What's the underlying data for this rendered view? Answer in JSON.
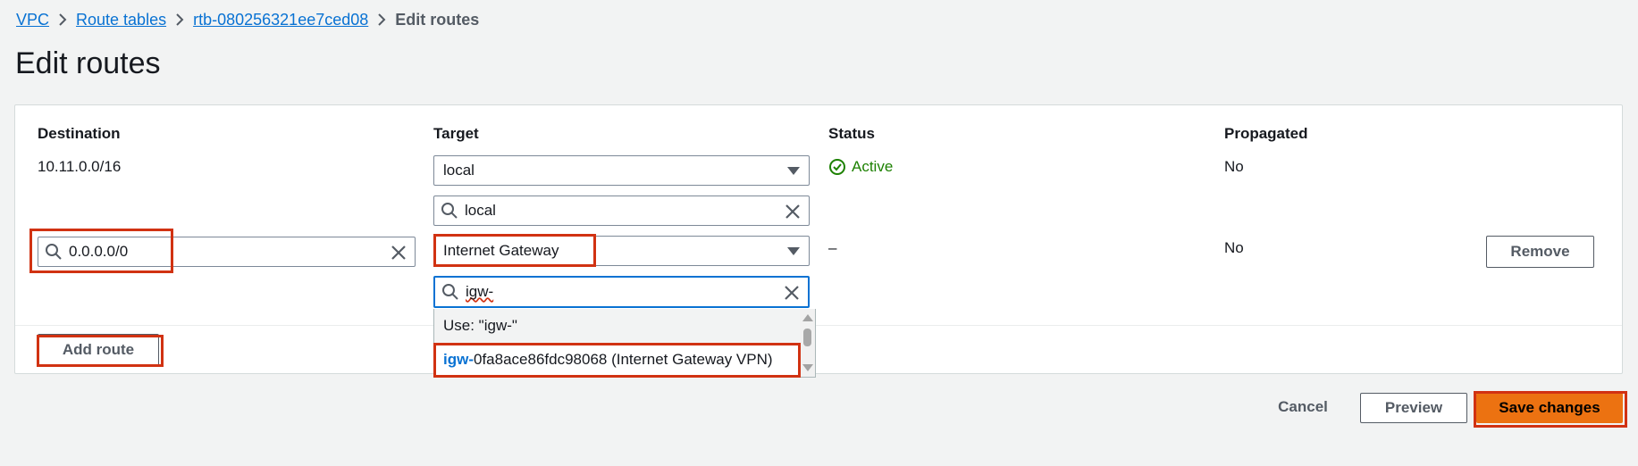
{
  "breadcrumb": {
    "items": [
      "VPC",
      "Route tables",
      "rtb-080256321ee7ced08"
    ],
    "current": "Edit routes"
  },
  "page": {
    "title": "Edit routes"
  },
  "table": {
    "headers": {
      "destination": "Destination",
      "target": "Target",
      "status": "Status",
      "propagated": "Propagated"
    },
    "rows": [
      {
        "destination": "10.11.0.0/16",
        "target_select": "local",
        "target_search": "local",
        "status": "Active",
        "propagated": "No"
      },
      {
        "destination_input": "0.0.0.0/0",
        "target_select": "Internet Gateway",
        "target_search": "igw-",
        "status": "–",
        "propagated": "No",
        "remove_label": "Remove"
      }
    ]
  },
  "dropdown": {
    "use_option": "Use: \"igw-\"",
    "option_match": "igw-",
    "option_rest": "0fa8ace86fdc98068 (Internet Gateway VPN)"
  },
  "buttons": {
    "add_route": "Add route",
    "cancel": "Cancel",
    "preview": "Preview",
    "save": "Save changes"
  },
  "colors": {
    "accent": "#0972d3",
    "primary_button": "#ec7211",
    "highlight": "#d13212",
    "status_active": "#1d8102"
  },
  "icons": [
    "chevron-right-icon",
    "search-icon",
    "clear-icon",
    "caret-down-icon",
    "status-success-icon"
  ]
}
